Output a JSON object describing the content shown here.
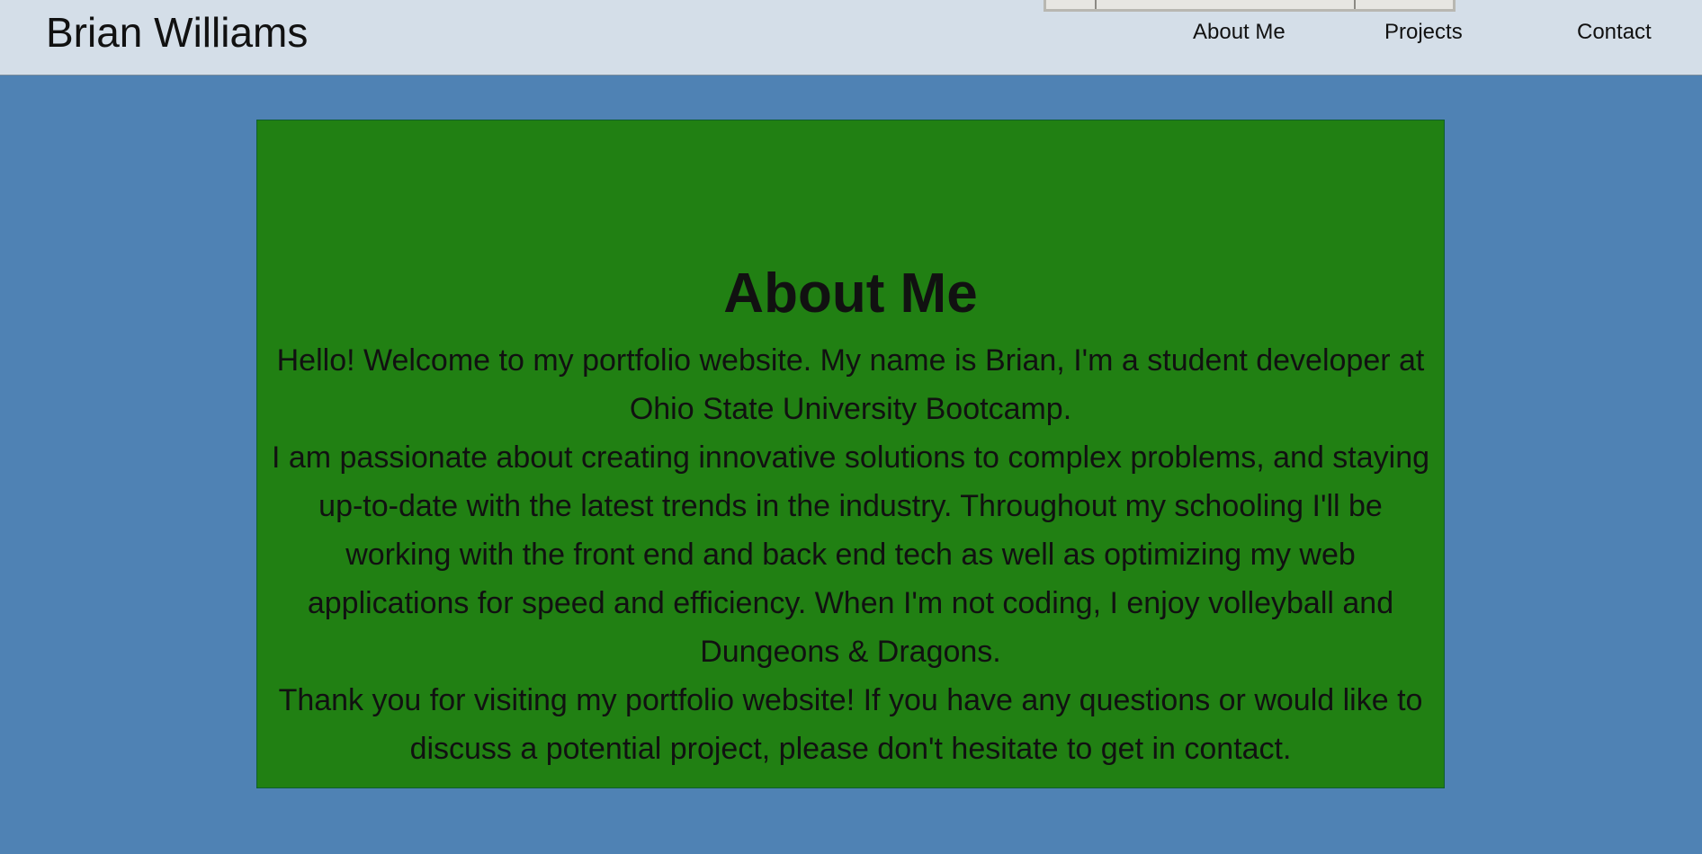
{
  "header": {
    "site_title": "Brian Williams",
    "nav": [
      {
        "label": "About Me"
      },
      {
        "label": "Projects"
      },
      {
        "label": "Contact"
      }
    ]
  },
  "about": {
    "heading": "About Me",
    "paragraphs": [
      "Hello! Welcome to my portfolio website. My name is Brian, I'm a student developer at Ohio State University Bootcamp.",
      "I am passionate about creating innovative solutions to complex problems, and staying up-to-date with the latest trends in the industry. Throughout my schooling I'll be working with the front end and back end tech as well as optimizing my web applications for speed and efficiency. When I'm not coding, I enjoy volleyball and Dungeons & Dragons.",
      "Thank you for visiting my portfolio website! If you have any questions or would like to discuss a potential project, please don't hesitate to get in contact."
    ]
  },
  "colors": {
    "page_background": "#4f82b4",
    "header_background": "#d4dee8",
    "card_background": "#218013",
    "text": "#111111"
  }
}
